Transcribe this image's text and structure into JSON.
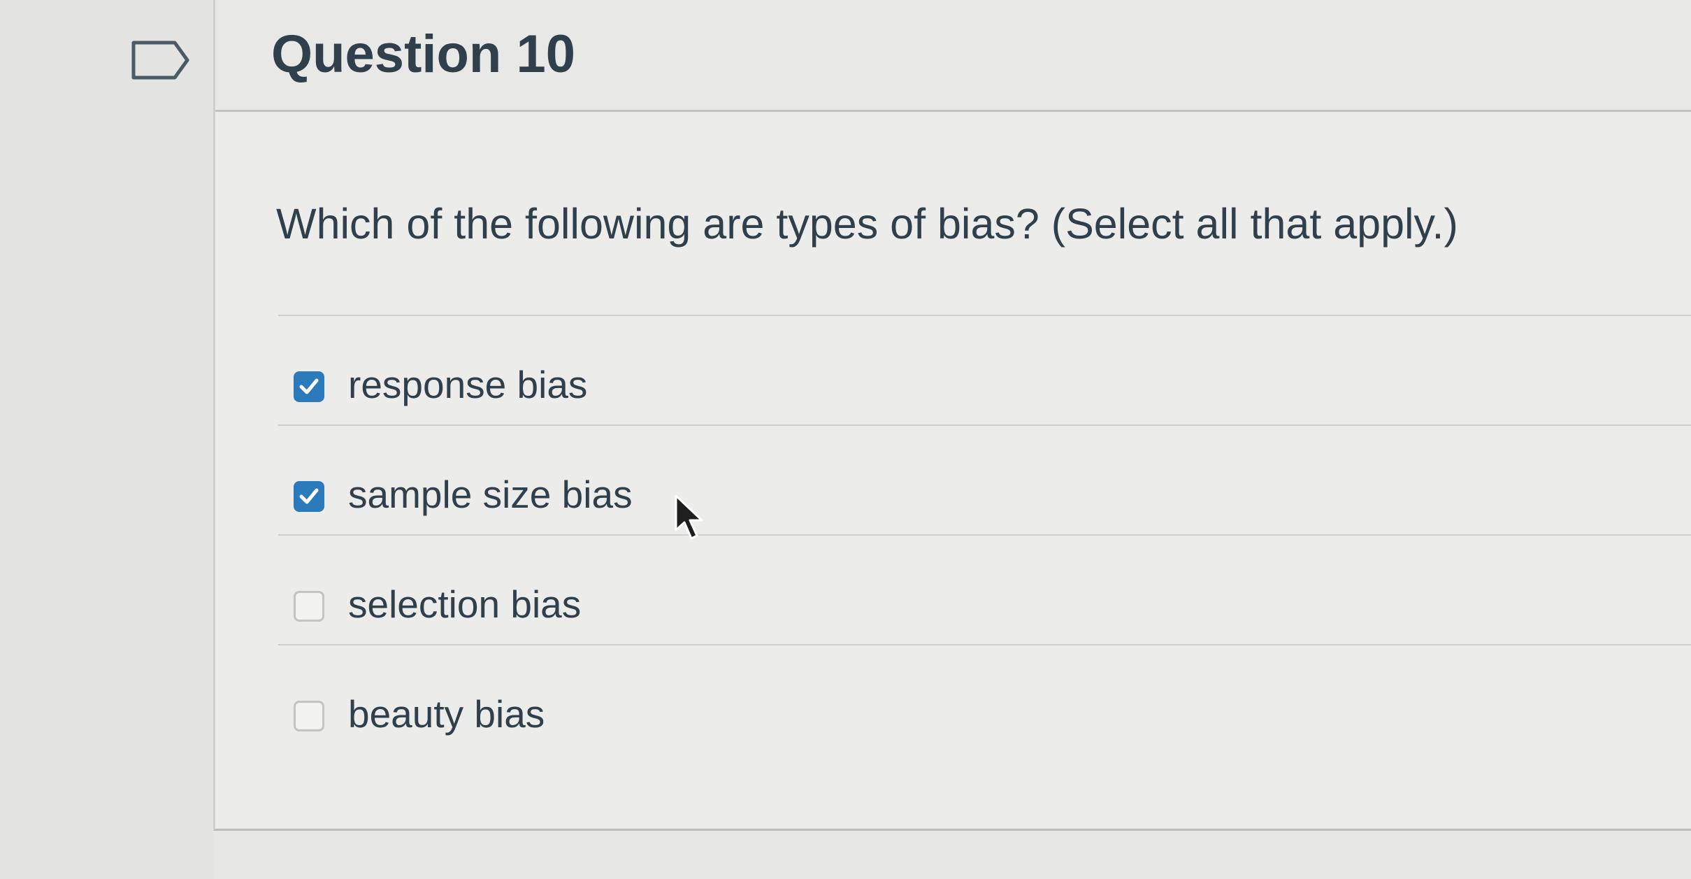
{
  "question": {
    "title": "Question 10",
    "text": "Which of the following are types of bias? (Select all that apply.)",
    "flag_icon": "bookmark-flag-icon",
    "options": [
      {
        "label": "response bias",
        "checked": true
      },
      {
        "label": "sample size bias",
        "checked": true
      },
      {
        "label": "selection bias",
        "checked": false
      },
      {
        "label": "beauty bias",
        "checked": false
      }
    ]
  },
  "colors": {
    "accent": "#2b7abc",
    "text": "#2f3f4b",
    "background": "#ececea"
  }
}
